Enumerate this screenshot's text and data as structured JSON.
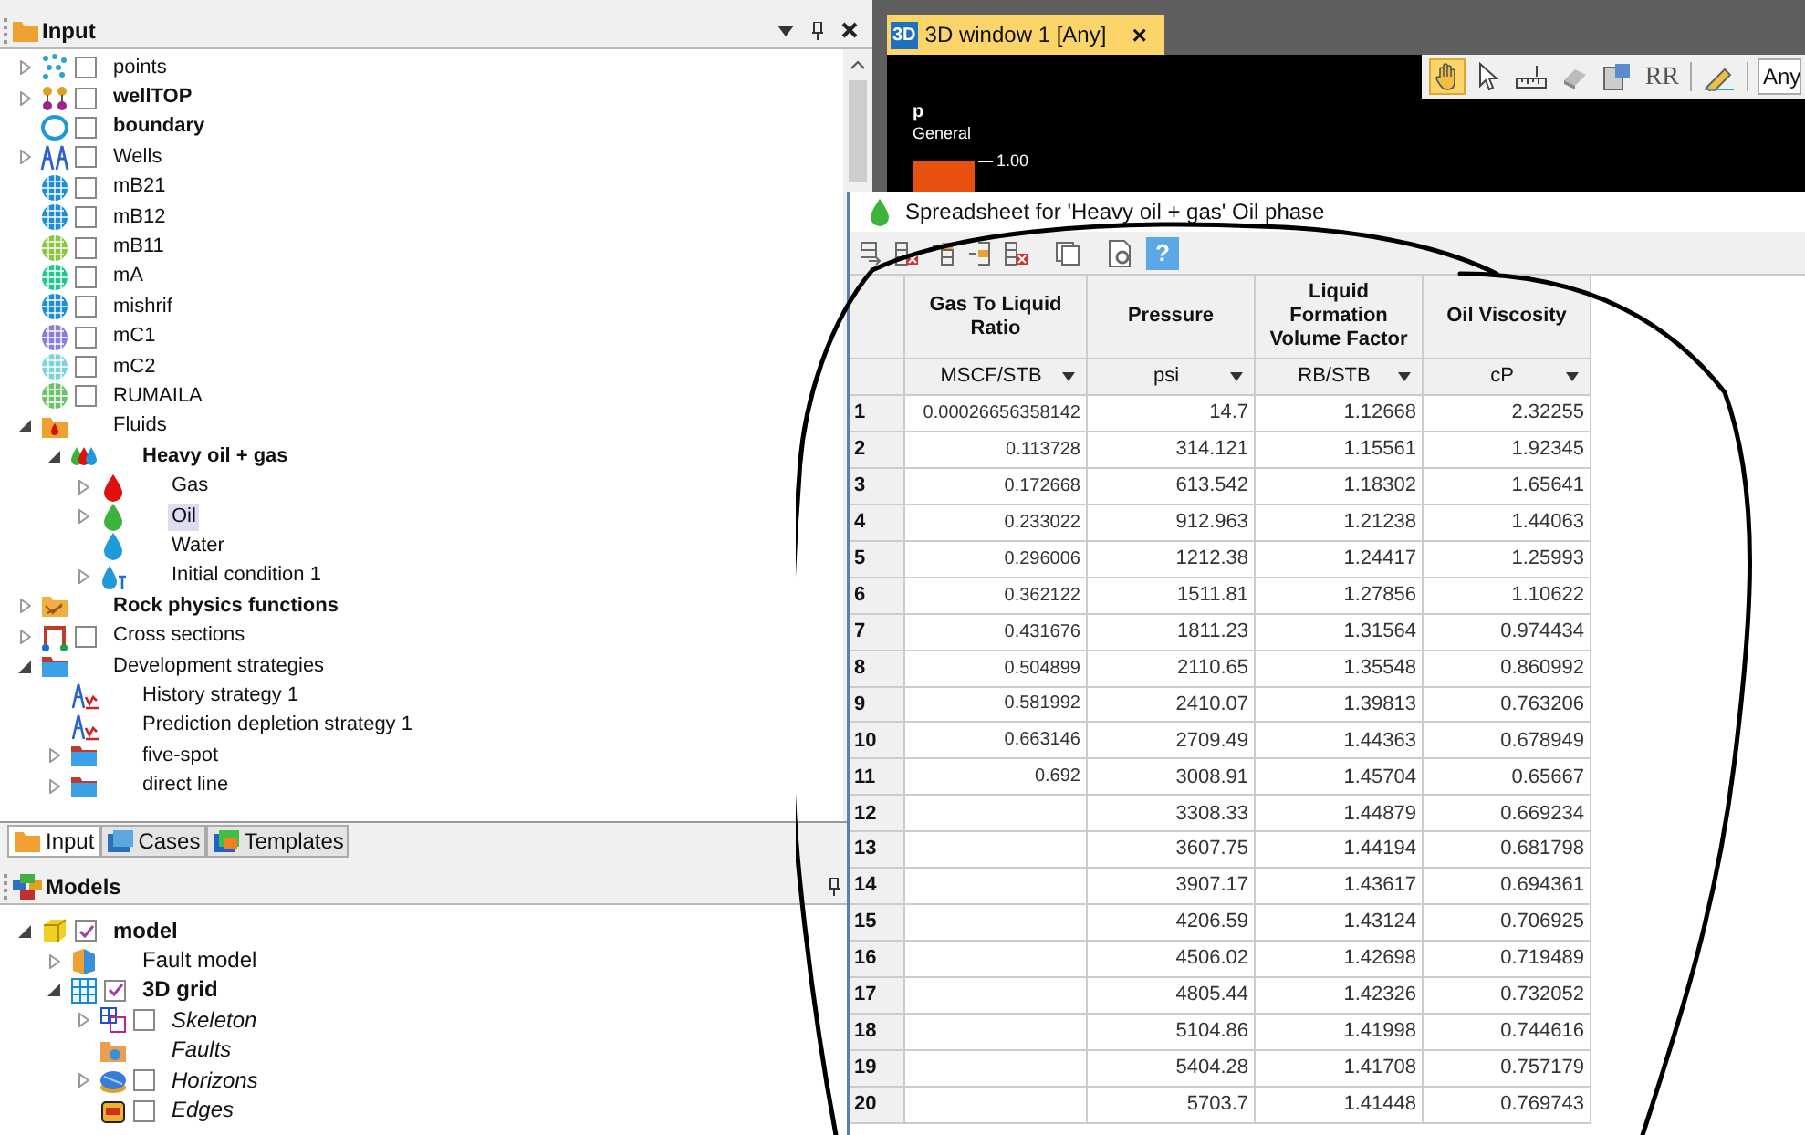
{
  "input_panel": {
    "title": "Input",
    "tree": [
      {
        "label": "points",
        "kind": "points",
        "expanded": false,
        "checked": false,
        "selected": false
      },
      {
        "label": "wellTOP",
        "kind": "well-top",
        "active": true,
        "expanded": false,
        "checked": false,
        "selected": false
      },
      {
        "label": "boundary",
        "kind": "boundary",
        "active": true,
        "checked": false,
        "selected": false
      },
      {
        "label": "Wells",
        "kind": "wells",
        "expanded": false,
        "checked": false,
        "selected": false
      },
      {
        "label": "mB21",
        "kind": "grid",
        "color": "#1e8fd6",
        "checked": false,
        "selected": false
      },
      {
        "label": "mB12",
        "kind": "grid",
        "color": "#1e8fd6",
        "checked": false,
        "selected": false
      },
      {
        "label": "mB11",
        "kind": "grid",
        "color": "#8cc63f",
        "checked": false,
        "selected": false
      },
      {
        "label": "mA",
        "kind": "grid",
        "color": "#22c78e",
        "checked": false,
        "selected": false
      },
      {
        "label": "mishrif",
        "kind": "grid",
        "color": "#1e8fd6",
        "checked": false,
        "selected": false
      },
      {
        "label": "mC1",
        "kind": "grid",
        "color": "#8a7fd8",
        "checked": false,
        "selected": false
      },
      {
        "label": "mC2",
        "kind": "grid",
        "color": "#7fd3d6",
        "checked": false,
        "selected": false
      },
      {
        "label": "RUMAILA",
        "kind": "grid",
        "color": "#6cc26c",
        "checked": false,
        "selected": false
      },
      {
        "label": "Fluids",
        "kind": "fluid-folder",
        "expanded": true,
        "selected": false,
        "children": [
          {
            "label": "Heavy oil + gas",
            "kind": "fluid-model",
            "active": true,
            "expanded": true,
            "selected": false,
            "children": [
              {
                "label": "Gas",
                "kind": "drop",
                "color": "#e01010",
                "expanded": false,
                "selected": false
              },
              {
                "label": "Oil",
                "kind": "drop",
                "color": "#3cb43c",
                "expanded": false,
                "selected": true
              },
              {
                "label": "Water",
                "kind": "drop",
                "color": "#1e9bd8",
                "selected": false
              },
              {
                "label": "Initial condition 1",
                "kind": "initial",
                "expanded": false,
                "selected": false
              }
            ]
          }
        ]
      },
      {
        "label": "Rock physics functions",
        "kind": "rock-folder",
        "active": true,
        "expanded": false,
        "selected": false
      },
      {
        "label": "Cross sections",
        "kind": "cross",
        "expanded": false,
        "checked": false,
        "selected": false
      },
      {
        "label": "Development strategies",
        "kind": "folder",
        "expanded": true,
        "selected": false,
        "children": [
          {
            "label": "History strategy 1",
            "kind": "strategy",
            "selected": false
          },
          {
            "label": "Prediction depletion strategy 1",
            "kind": "strategy",
            "selected": false
          },
          {
            "label": "five-spot",
            "kind": "folder",
            "expanded": false,
            "selected": false
          },
          {
            "label": "direct line",
            "kind": "folder",
            "expanded": false,
            "selected": false
          }
        ]
      }
    ]
  },
  "panel_tabs": [
    {
      "label": "Input",
      "kind": "folder-tab",
      "selected": true
    },
    {
      "label": "Cases",
      "kind": "cases",
      "selected": false
    },
    {
      "label": "Templates",
      "kind": "templates",
      "selected": false
    }
  ],
  "models_panel": {
    "title": "Models",
    "tree": [
      {
        "label": "model",
        "kind": "model",
        "active": true,
        "expanded": true,
        "checked": true,
        "selected": false,
        "children": [
          {
            "label": "Fault model",
            "kind": "fault-model",
            "expanded": false,
            "selected": false
          },
          {
            "label": "3D grid",
            "kind": "grid3d",
            "active": true,
            "expanded": true,
            "checked": true,
            "selected": false,
            "children": [
              {
                "label": "Skeleton",
                "kind": "skeleton",
                "empty": true,
                "expanded": false,
                "checked": false,
                "selected": false
              },
              {
                "label": "Faults",
                "kind": "faults",
                "empty": true,
                "selected": false
              },
              {
                "label": "Horizons",
                "kind": "horizons",
                "empty": true,
                "expanded": false,
                "checked": false,
                "selected": false
              },
              {
                "label": "Edges",
                "kind": "edges",
                "empty": true,
                "checked": false,
                "selected": false
              }
            ]
          }
        ]
      }
    ]
  },
  "window_tab": {
    "badge": "3D",
    "title": "3D window 1 [Any]",
    "close": "×"
  },
  "viewer": {
    "toolbar": [
      {
        "kind": "hand",
        "selected": true
      },
      {
        "kind": "pointer",
        "selected": false
      },
      {
        "kind": "ruler",
        "selected": false
      },
      {
        "kind": "eraser",
        "selected": false
      },
      {
        "kind": "layers",
        "selected": false
      },
      {
        "kind": "text",
        "label": "RR",
        "selected": false
      },
      {
        "kind": "separator"
      },
      {
        "kind": "draw",
        "selected": false
      },
      {
        "kind": "separator"
      }
    ],
    "field_value": "Any",
    "legend": {
      "title": "p",
      "subtitle": "General",
      "tick": "1.00"
    }
  },
  "spreadsheet": {
    "title": "Spreadsheet for 'Heavy oil + gas' Oil phase",
    "toolbar": [
      {
        "kind": "append"
      },
      {
        "kind": "delete"
      },
      {
        "kind": "insert-above"
      },
      {
        "kind": "insert-below"
      },
      {
        "kind": "delete"
      },
      {
        "kind": "copy"
      },
      {
        "kind": "settings"
      },
      {
        "kind": "help",
        "label": "?"
      }
    ],
    "columns": [
      {
        "title": "Gas To Liquid Ratio",
        "unit": "MSCF/STB"
      },
      {
        "title": "Pressure",
        "unit": "psi"
      },
      {
        "title": "Liquid Formation Volume Factor",
        "unit": "RB/STB"
      },
      {
        "title": "Oil Viscosity",
        "unit": "cP"
      }
    ],
    "rows": [
      {
        "number": "1",
        "cells": [
          "0.00026656358142",
          "14.7",
          "1.12668",
          "2.32255"
        ]
      },
      {
        "number": "2",
        "cells": [
          "0.113728",
          "314.121",
          "1.15561",
          "1.92345"
        ]
      },
      {
        "number": "3",
        "cells": [
          "0.172668",
          "613.542",
          "1.18302",
          "1.65641"
        ]
      },
      {
        "number": "4",
        "cells": [
          "0.233022",
          "912.963",
          "1.21238",
          "1.44063"
        ]
      },
      {
        "number": "5",
        "cells": [
          "0.296006",
          "1212.38",
          "1.24417",
          "1.25993"
        ]
      },
      {
        "number": "6",
        "cells": [
          "0.362122",
          "1511.81",
          "1.27856",
          "1.10622"
        ]
      },
      {
        "number": "7",
        "cells": [
          "0.431676",
          "1811.23",
          "1.31564",
          "0.974434"
        ]
      },
      {
        "number": "8",
        "cells": [
          "0.504899",
          "2110.65",
          "1.35548",
          "0.860992"
        ]
      },
      {
        "number": "9",
        "cells": [
          "0.581992",
          "2410.07",
          "1.39813",
          "0.763206"
        ]
      },
      {
        "number": "10",
        "cells": [
          "0.663146",
          "2709.49",
          "1.44363",
          "0.678949"
        ]
      },
      {
        "number": "11",
        "cells": [
          "0.692",
          "3008.91",
          "1.45704",
          "0.65667"
        ]
      },
      {
        "number": "12",
        "cells": [
          null,
          "3308.33",
          "1.44879",
          "0.669234"
        ]
      },
      {
        "number": "13",
        "cells": [
          null,
          "3607.75",
          "1.44194",
          "0.681798"
        ]
      },
      {
        "number": "14",
        "cells": [
          null,
          "3907.17",
          "1.43617",
          "0.694361"
        ]
      },
      {
        "number": "15",
        "cells": [
          null,
          "4206.59",
          "1.43124",
          "0.706925"
        ]
      },
      {
        "number": "16",
        "cells": [
          null,
          "4506.02",
          "1.42698",
          "0.719489"
        ]
      },
      {
        "number": "17",
        "cells": [
          null,
          "4805.44",
          "1.42326",
          "0.732052"
        ]
      },
      {
        "number": "18",
        "cells": [
          null,
          "5104.86",
          "1.41998",
          "0.744616"
        ]
      },
      {
        "number": "19",
        "cells": [
          null,
          "5404.28",
          "1.41708",
          "0.757179"
        ]
      },
      {
        "number": "20",
        "cells": [
          null,
          "5703.7",
          "1.41448",
          "0.769743"
        ]
      }
    ]
  }
}
